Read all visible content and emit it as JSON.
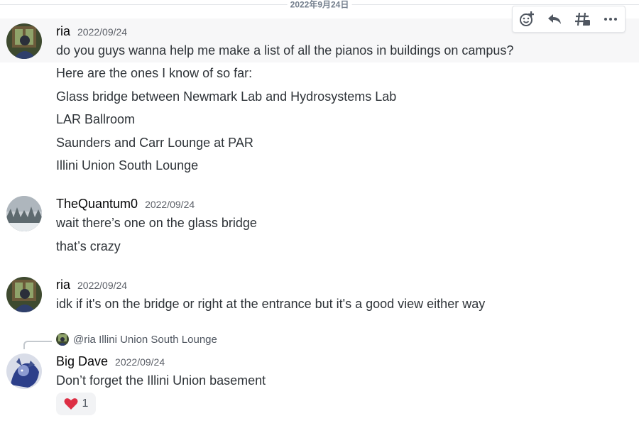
{
  "date_divider": "2022年9月24日",
  "toolbar": {
    "icons": [
      "add-reaction-icon",
      "reply-icon",
      "create-thread-icon",
      "more-icon"
    ]
  },
  "messages": [
    {
      "author": "ria",
      "timestamp": "2022/09/24",
      "lines": [
        "do you guys wanna help me make a list of all the pianos in buildings on campus?",
        "Here are the ones I know of so far:",
        "Glass bridge between Newmark Lab and Hydrosystems Lab",
        "LAR Ballroom",
        "Saunders and Carr Lounge at PAR",
        "Illini Union South Lounge"
      ]
    },
    {
      "author": "TheQuantum0",
      "timestamp": "2022/09/24",
      "lines": [
        "wait there’s one on the glass bridge",
        "that’s crazy"
      ]
    },
    {
      "author": "ria",
      "timestamp": "2022/09/24",
      "lines": [
        "idk if it's on the bridge or right at the entrance but it's a good view either way"
      ]
    },
    {
      "author": "Big Dave",
      "timestamp": "2022/09/24",
      "reply_preview": "@ria Illini Union South Lounge",
      "lines": [
        "Don’t forget the Illini Union basement"
      ],
      "reaction": {
        "emoji": "heart",
        "count": "1",
        "color": "#dd2e44"
      }
    }
  ]
}
